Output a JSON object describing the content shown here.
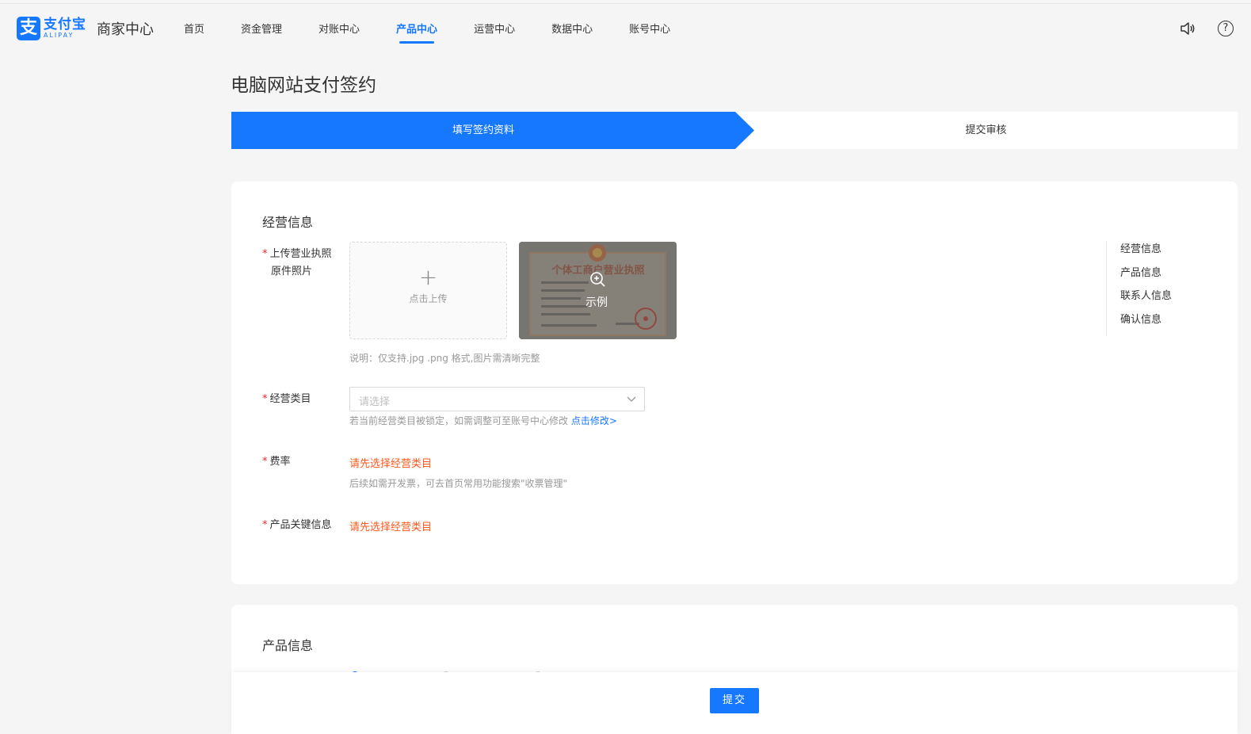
{
  "header": {
    "logo_cn": "支付宝",
    "logo_en": "ALIPAY",
    "logo_mark": "支",
    "brand_title": "商家中心",
    "nav": [
      "首页",
      "资金管理",
      "对账中心",
      "产品中心",
      "运营中心",
      "数据中心",
      "账号中心"
    ],
    "active_nav": "产品中心",
    "help_glyph": "?"
  },
  "page": {
    "title": "电脑网站支付签约"
  },
  "steps": {
    "current": "填写签约资料",
    "next": "提交审核"
  },
  "business_section": {
    "title": "经营信息",
    "required_mark": "*",
    "upload_label_line1": "上传营业执照",
    "upload_label_line2": "原件照片",
    "upload_plus": "+",
    "upload_text": "点击上传",
    "example_text": "示例",
    "example_image_title": "个体工商户营业执照",
    "upload_note": "说明：仅支持.jpg .png 格式,图片需清晰完整",
    "category_label": "经营类目",
    "category_placeholder": "请选择",
    "category_note": "若当前经营类目被锁定，如需调整可至账号中心修改",
    "category_link": "点击修改>",
    "rate_label": "费率",
    "rate_warning": "请先选择经营类目",
    "rate_note": "后续如需开发票，可去首页常用功能搜索\"收票管理\"",
    "key_info_label": "产品关键信息",
    "key_info_warning": "请先选择经营类目"
  },
  "anchor_nav": [
    "经营信息",
    "产品信息",
    "联系人信息",
    "确认信息"
  ],
  "product_section": {
    "title": "产品信息"
  },
  "footer": {
    "submit": "提交"
  },
  "colors": {
    "primary": "#1677ff",
    "warning": "#ff5a1f",
    "required": "#f5222d"
  }
}
